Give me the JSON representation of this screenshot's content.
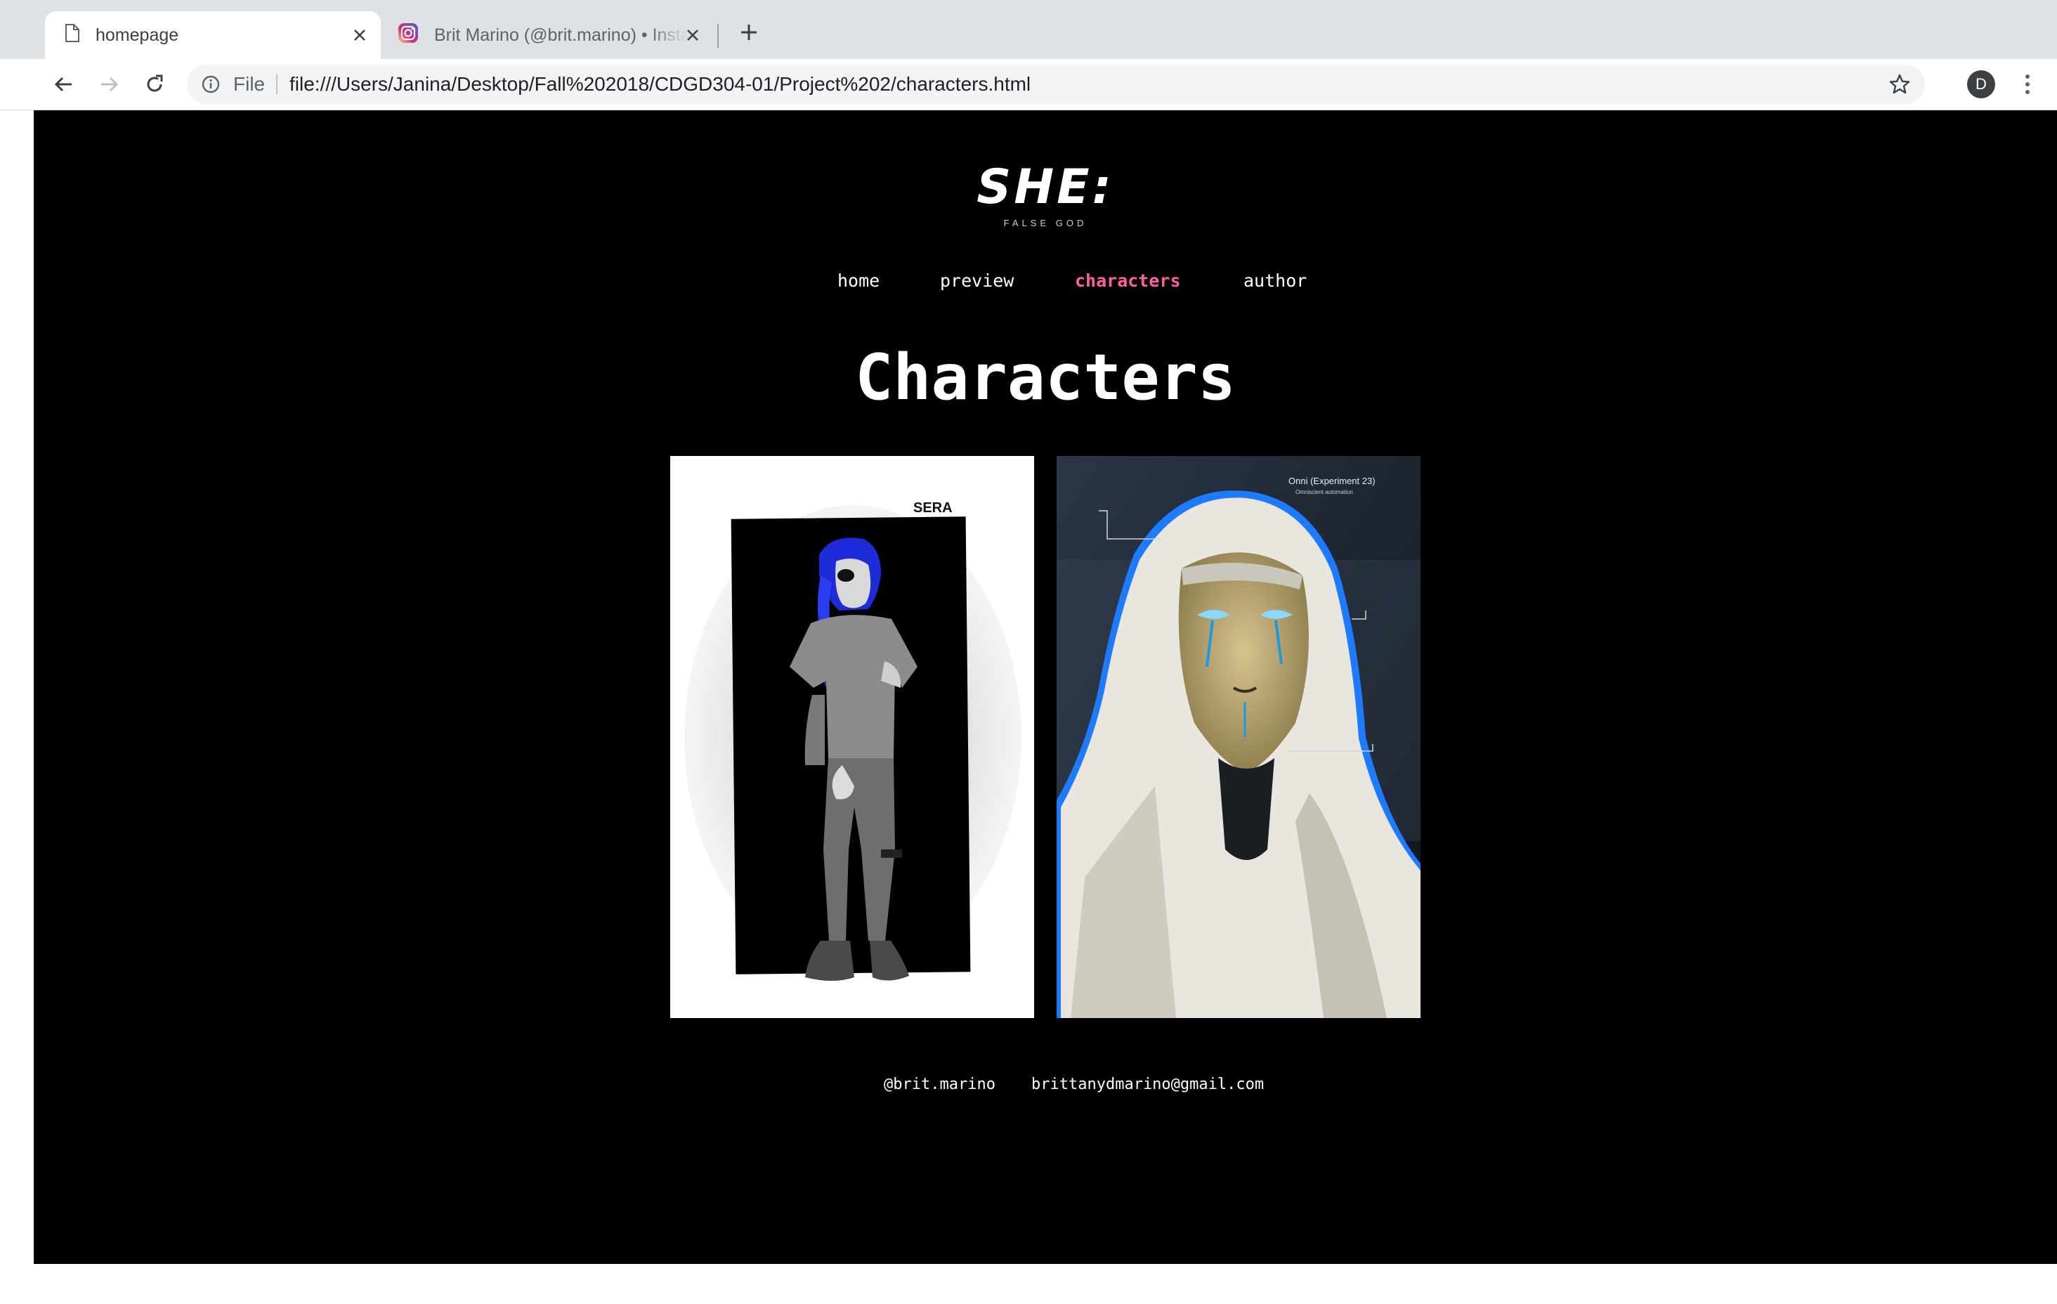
{
  "browser": {
    "tabs": [
      {
        "title": "homepage",
        "icon": "document-icon",
        "active": true
      },
      {
        "title": "Brit Marino (@brit.marino) • Instagram",
        "icon": "instagram-icon",
        "active": false
      }
    ],
    "omnibox": {
      "scheme": "File",
      "url": "file:///Users/Janina/Desktop/Fall%202018/CDGD304-01/Project%202/characters.html"
    },
    "profile_initial": "D"
  },
  "site": {
    "logo": "SHE:",
    "tagline": "FALSE GOD",
    "nav": [
      {
        "label": "home"
      },
      {
        "label": "preview"
      },
      {
        "label": "characters",
        "active": true
      },
      {
        "label": "author"
      }
    ],
    "heading": "Characters",
    "images": [
      {
        "signature": "SERA"
      },
      {
        "label": "Onni (Experiment 23)",
        "sublabel": "Omniscient automation"
      }
    ],
    "footer": {
      "instagram": "@brit.marino",
      "email": "brittanydmarino@gmail.com"
    }
  },
  "colors": {
    "page_bg": "#000000",
    "active_nav": "#ff5fa2",
    "tabstrip": "#dee1e6"
  }
}
